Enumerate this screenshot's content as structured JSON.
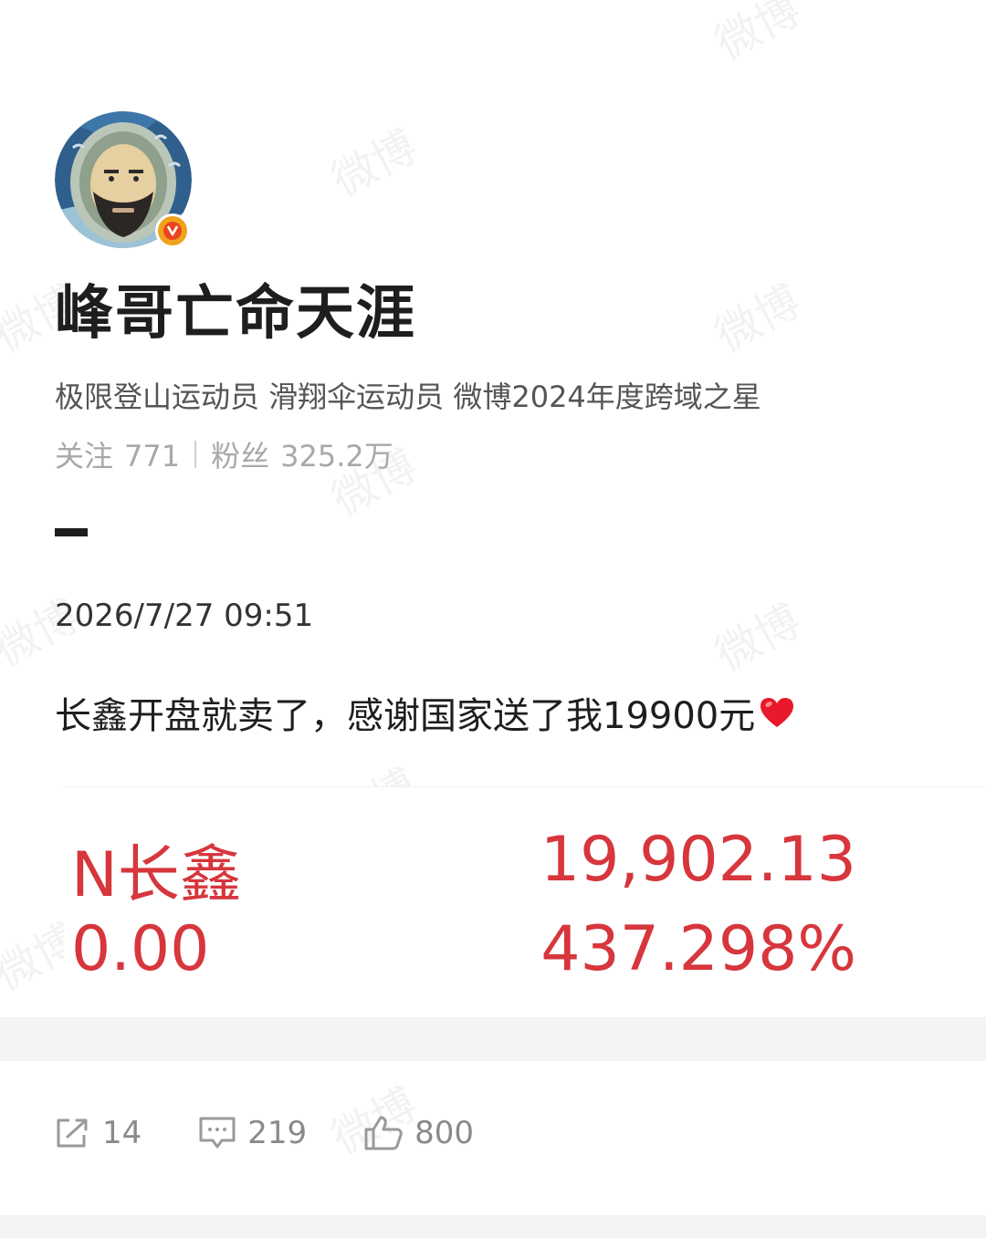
{
  "profile": {
    "username": "峰哥亡命天涯",
    "verified_badge_letter": "v",
    "bio": "极限登山运动员 滑翔伞运动员 微博2024年度跨域之星",
    "following_label": "关注",
    "following_count": "771",
    "followers_label": "粉丝",
    "followers_count": "325.2万"
  },
  "post": {
    "timestamp": "2026/7/27 09:51",
    "text": "长鑫开盘就卖了，感谢国家送了我19900元"
  },
  "stock_card": {
    "name": "N长鑫",
    "price": "19,902.13",
    "change": "0.00",
    "change_pct": "437.298%"
  },
  "actions": {
    "repost_count": "14",
    "comment_count": "219",
    "like_count": "800"
  },
  "watermark_text": "微博",
  "colors": {
    "stock_red": "#d6363c",
    "verified_orange": "#f0a21c",
    "muted_gray": "#a8a8a8",
    "heart_red": "#e8192c"
  }
}
